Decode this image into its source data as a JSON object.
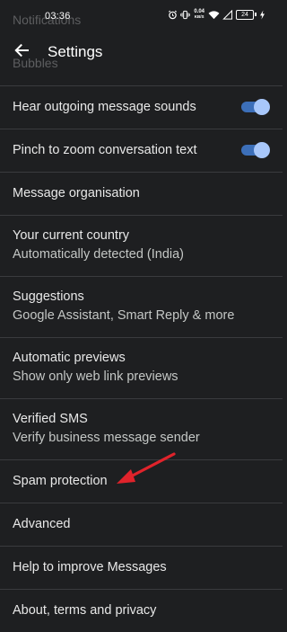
{
  "status_bar": {
    "time": "03:36",
    "net_speed_value": "0.04",
    "net_speed_unit": "KB/S",
    "battery": "24"
  },
  "background_text": {
    "notifications": "Notifications",
    "bubbles": "Bubbles"
  },
  "app_bar": {
    "title": "Settings"
  },
  "settings": {
    "hear_sounds": {
      "label": "Hear outgoing message sounds",
      "enabled": true
    },
    "pinch_zoom": {
      "label": "Pinch to zoom conversation text",
      "enabled": true
    },
    "message_organisation": {
      "label": "Message organisation"
    },
    "country": {
      "label": "Your current country",
      "summary": "Automatically detected (India)"
    },
    "suggestions": {
      "label": "Suggestions",
      "summary": "Google Assistant, Smart Reply & more"
    },
    "automatic_previews": {
      "label": "Automatic previews",
      "summary": "Show only web link previews"
    },
    "verified_sms": {
      "label": "Verified SMS",
      "summary": "Verify business message sender"
    },
    "spam_protection": {
      "label": "Spam protection"
    },
    "advanced": {
      "label": "Advanced"
    },
    "help_improve": {
      "label": "Help to improve Messages"
    },
    "about": {
      "label": "About, terms and privacy"
    }
  },
  "colors": {
    "background": "#1e1f21",
    "divider": "#3a3b3e",
    "toggle_track": "#3c6fb9",
    "toggle_knob": "#a8c7fa",
    "annotation_arrow": "#e0232b"
  }
}
